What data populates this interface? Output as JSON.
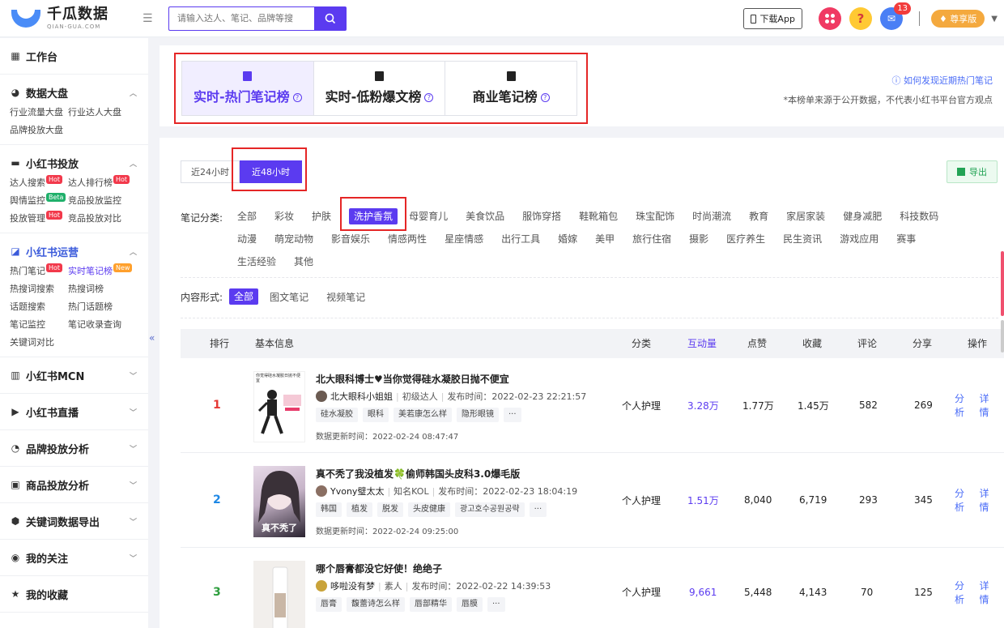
{
  "header": {
    "logo_cn": "千瓜数据",
    "logo_en": "QIAN-GUA.COM",
    "search_placeholder": "请输入达人、笔记、品牌等搜",
    "download_label": "下载App",
    "mail_count": "13",
    "vip_label": "尊享版"
  },
  "sidebar": {
    "workbench": "工作台",
    "groups": [
      {
        "title": "数据大盘",
        "items": [
          {
            "label": "行业流量大盘"
          },
          {
            "label": "行业达人大盘"
          },
          {
            "label": "品牌投放大盘"
          }
        ]
      },
      {
        "title": "小红书投放",
        "items": [
          {
            "label": "达人搜索",
            "tag": "Hot"
          },
          {
            "label": "达人排行榜",
            "tag": "Hot"
          },
          {
            "label": "舆情监控",
            "tag": "Beta"
          },
          {
            "label": "竞品投放监控"
          },
          {
            "label": "投放管理",
            "tag": "Hot"
          },
          {
            "label": "竞品投放对比"
          }
        ]
      },
      {
        "title": "小红书运营",
        "items": [
          {
            "label": "热门笔记",
            "tag": "Hot"
          },
          {
            "label": "实时笔记榜",
            "tag": "New"
          },
          {
            "label": "热搜词搜索"
          },
          {
            "label": "热搜词榜"
          },
          {
            "label": "话题搜索"
          },
          {
            "label": "热门话题榜"
          },
          {
            "label": "笔记监控"
          },
          {
            "label": "笔记收录查询"
          },
          {
            "label": "关键词对比"
          }
        ]
      },
      {
        "title": "小红书MCN"
      },
      {
        "title": "小红书直播"
      },
      {
        "title": "品牌投放分析"
      },
      {
        "title": "商品投放分析"
      },
      {
        "title": "关键词数据导出"
      },
      {
        "title": "我的关注"
      },
      {
        "title": "我的收藏"
      }
    ]
  },
  "rank_tabs": [
    {
      "label": "实时-热门笔记榜"
    },
    {
      "label": "实时-低粉爆文榜"
    },
    {
      "label": "商业笔记榜"
    }
  ],
  "help_link": "如何发现近期热门笔记",
  "source_note": "*本榜单来源于公开数据，不代表小红书平台官方观点",
  "time_tabs": [
    "近24小时",
    "近48小时"
  ],
  "export_label": "导出",
  "category": {
    "label": "笔记分类:",
    "items": [
      "全部",
      "彩妆",
      "护肤",
      "洗护香氛",
      "母婴育儿",
      "美食饮品",
      "服饰穿搭",
      "鞋靴箱包",
      "珠宝配饰",
      "时尚潮流",
      "教育",
      "家居家装",
      "健身减肥",
      "科技数码",
      "动漫",
      "萌宠动物",
      "影音娱乐",
      "情感两性",
      "星座情感",
      "出行工具",
      "婚嫁",
      "美甲",
      "旅行住宿",
      "摄影",
      "医疗养生",
      "民生资讯",
      "游戏应用",
      "赛事",
      "生活经验",
      "其他"
    ],
    "selected": "洗护香氛"
  },
  "format": {
    "label": "内容形式:",
    "items": [
      "全部",
      "图文笔记",
      "视频笔记"
    ],
    "selected": "全部"
  },
  "table": {
    "headers": {
      "rank": "排行",
      "info": "基本信息",
      "category": "分类",
      "interactions": "互动量",
      "likes": "点赞",
      "collects": "收藏",
      "comments": "评论",
      "shares": "分享",
      "ops": "操作"
    },
    "rows": [
      {
        "rank": "1",
        "thumb_caption": "你觉得硅水凝胶日抛不便宜",
        "title": "北大眼科博士♥当你觉得硅水凝胶日抛不便宜",
        "author": "北大眼科小姐姐",
        "level": "初级达人",
        "published": "发布时间：2022-02-23 22:21:57",
        "tags": [
          "硅水凝胶",
          "眼科",
          "美若康怎么样",
          "隐形眼镜",
          "···"
        ],
        "updated": "数据更新时间：2022-02-24 08:47:47",
        "category": "个人护理",
        "interactions": "3.28万",
        "likes": "1.77万",
        "collects": "1.45万",
        "comments": "582",
        "shares": "269",
        "op_analyze": "分析",
        "op_detail": "详情"
      },
      {
        "rank": "2",
        "thumb_caption": "真不秃了",
        "title": "真不秃了我没植发🍀偷师韩国头皮科3.0爆毛版",
        "author": "Yvony璧太太",
        "level": "知名KOL",
        "published": "发布时间：2022-02-23 18:04:19",
        "tags": [
          "韩国",
          "植发",
          "脱发",
          "头皮健康",
          "광고호수공원공략",
          "···"
        ],
        "updated": "数据更新时间：2022-02-24 09:25:00",
        "category": "个人护理",
        "interactions": "1.51万",
        "likes": "8,040",
        "collects": "6,719",
        "comments": "293",
        "shares": "345",
        "op_analyze": "分析",
        "op_detail": "详情"
      },
      {
        "rank": "3",
        "title": "哪个唇膏都没它好使！绝绝子",
        "author": "哆啦没有梦",
        "level": "素人",
        "published": "发布时间：2022-02-22 14:39:53",
        "tags": [
          "唇膏",
          "馥蕾诗怎么样",
          "唇部精华",
          "唇膜",
          "···"
        ],
        "category": "个人护理",
        "interactions": "9,661",
        "likes": "5,448",
        "collects": "4,143",
        "comments": "70",
        "shares": "125",
        "op_analyze": "分析",
        "op_detail": "详情"
      }
    ]
  },
  "colors": {
    "accent": "#5b3bf0",
    "highlight_box": "#e52626",
    "rank1": "#e53935",
    "rank2": "#1e88e5",
    "rank3": "#2e9e3e"
  }
}
